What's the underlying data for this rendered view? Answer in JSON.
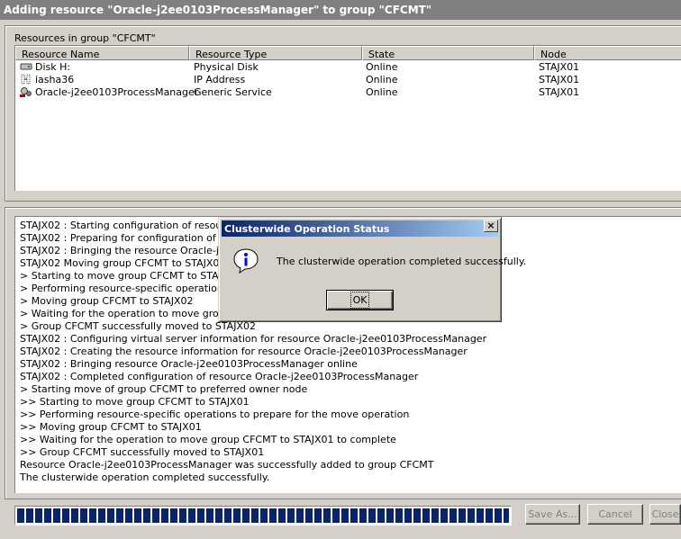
{
  "window": {
    "title": "Adding resource \"Oracle-j2ee0103ProcessManager\" to group \"CFCMT\""
  },
  "resources": {
    "label": "Resources in group \"CFCMT\"",
    "columns": [
      "Resource Name",
      "Resource Type",
      "State",
      "Node"
    ],
    "rows": [
      {
        "icon": "disk-icon",
        "name": "Disk H:",
        "type": "Physical Disk",
        "state": "Online",
        "node": "STAJX01"
      },
      {
        "icon": "ip-address-icon",
        "name": "iasha36",
        "type": "IP Address",
        "state": "Online",
        "node": "STAJX01"
      },
      {
        "icon": "generic-service-icon",
        "name": "Oracle-j2ee0103ProcessManager",
        "type": "Generic Service",
        "state": "Online",
        "node": "STAJX01"
      }
    ]
  },
  "log": [
    "STAJX02 : Starting configuration of resource O",
    "STAJX02 : Preparing for configuration of resou",
    "STAJX02 : Bringing the resource Oracle-j2ee01",
    "STAJX02 Moving group CFCMT to STAJX02",
    "> Starting to move group CFCMT to STAJX02",
    "> Performing resource-specific operations to pr",
    "> Moving group CFCMT to STAJX02",
    "> Waiting for the operation to move group CFC",
    "> Group CFCMT successfully moved to STAJX02",
    "STAJX02 : Configuring virtual server information for resource Oracle-j2ee0103ProcessManager",
    "STAJX02 : Creating the resource information for resource Oracle-j2ee0103ProcessManager",
    "STAJX02 : Bringing resource Oracle-j2ee0103ProcessManager online",
    "STAJX02 : Completed configuration of resource Oracle-j2ee0103ProcessManager",
    "> Starting move of group CFCMT to preferred owner node",
    ">> Starting to move group CFCMT to STAJX01",
    ">> Performing resource-specific operations to prepare for the move operation",
    ">> Moving group CFCMT to STAJX01",
    ">> Waiting for the operation to move group CFCMT to STAJX01 to complete",
    ">> Group CFCMT successfully moved to STAJX01",
    "Resource Oracle-j2ee0103ProcessManager was successfully added to group CFCMT",
    "The clusterwide operation completed successfully."
  ],
  "progress": {
    "fraction": 1.0,
    "color": "#0a246a"
  },
  "buttons": {
    "save_as": "Save As...",
    "cancel": "Cancel",
    "close": "Close"
  },
  "dialog": {
    "title": "Clusterwide Operation Status",
    "close_glyph": "×",
    "message": "The clusterwide operation completed successfully.",
    "ok": "OK",
    "icon": "information-icon"
  }
}
